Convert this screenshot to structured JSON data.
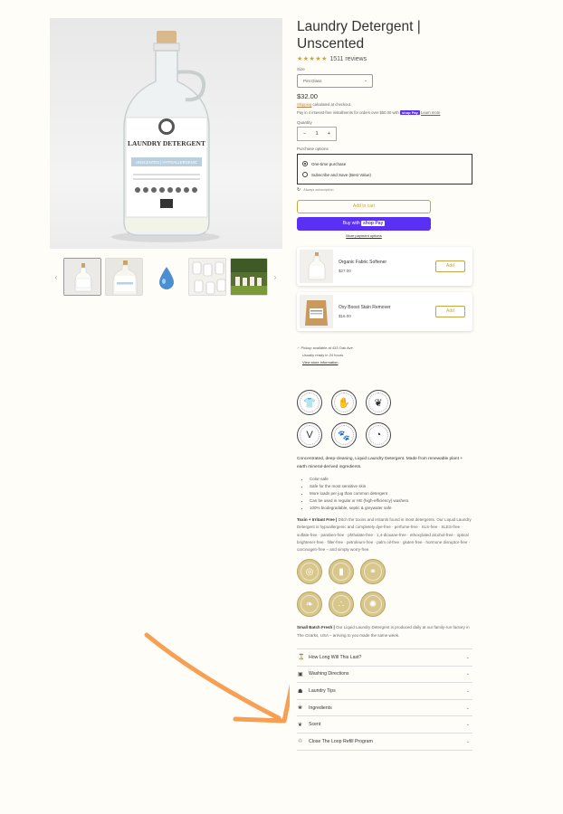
{
  "product": {
    "title": "Laundry Detergent | Unscented",
    "stars": "★★★★★",
    "review_count": "1511 reviews",
    "size_label": "Size",
    "size_value": "Pint Glass",
    "price": "$32.00",
    "shipping_link": "Shipping",
    "shipping_text": " calculated at checkout.",
    "installments_text": "Pay in 4 interest-free installments for orders over $50.00 with ",
    "shop_pay": "shop Pay",
    "learn_more": "Learn more",
    "quantity_label": "Quantity",
    "quantity_value": "1",
    "minus": "−",
    "plus": "+",
    "purchase_label": "Purchase options",
    "option_one_time": "One-time purchase",
    "option_subscribe": "Subscribe and Save (Best Value)",
    "policy_text": "Always subscription",
    "add_to_cart": "Add to cart",
    "buy_with": "Buy with ",
    "buy_shop": "shop Pay",
    "more_payment": "More payment options"
  },
  "gallery": {
    "label_brand": "LAUNDRY DETERGENT",
    "label_sub": "UNSCENTED | HYPOALLERGENIC",
    "prev_arrow": "‹",
    "next_arrow": "›"
  },
  "recommendations": [
    {
      "name": "Organic Fabric Softener",
      "price": "$27.00",
      "button": "Add"
    },
    {
      "name": "Oxy Boost Stain Remover",
      "price": "$16.00",
      "button": "Add"
    }
  ],
  "pickup": {
    "check": "✓",
    "line1": "Pickup available at 433 Oak Ave",
    "line2": "Usually ready in 24 hours",
    "link": "View store information"
  },
  "description": {
    "intro": "Concentrated, deep-cleaning, Liquid Laundry Detergent. Made from renewable plant + earth mineral-derived ingredients.",
    "bullets": [
      "Color-safe",
      "Safe for the most sensitive skin",
      "More loads per jug than common detergent",
      "Can be used in regular or HE (high-efficiency) washers.",
      "100% biodegradable, septic & greywater safe"
    ],
    "toxins_heading": "Toxin + Irritant Free |",
    "toxins_body": " Ditch the toxins and irritants found in most detergents. Our Liquid Laundry Detergent is hypoallergenic and completely dye-free · perfume-free · SLS-free · SLES-free · sulfate-free · paraben-free · phthalate-free · 1,4-dioxane-free · ethoxylated alcohol-free · optical brightener-free · filler-free · petroleum-free · palm oil-free · gluten-free · hormone disruptor-free · carcinogen-free – and simply worry-free.",
    "batch_heading": "Small Batch Fresh |",
    "batch_body": " Our Liquid Laundry Detergent is produced daily at our family-run factory in The Ozarks, USA – arriving to you made the same week."
  },
  "badges": [
    {
      "icon": "tshirt-icon",
      "glyph": "👕"
    },
    {
      "icon": "hands-icon",
      "glyph": "✋"
    },
    {
      "icon": "leaf-icon",
      "glyph": "❦"
    },
    {
      "icon": "vegan-icon",
      "glyph": "V"
    },
    {
      "icon": "paw-icon",
      "glyph": "🐾"
    },
    {
      "icon": "recycle-icon",
      "glyph": "◔"
    }
  ],
  "gold_badges": [
    {
      "icon": "no-residue-icon",
      "glyph": "◎"
    },
    {
      "icon": "bottle-icon",
      "glyph": "▮"
    },
    {
      "icon": "bone-icon",
      "glyph": "⚭"
    },
    {
      "icon": "wheat-icon",
      "glyph": "❧"
    },
    {
      "icon": "drops-icon",
      "glyph": "∴"
    },
    {
      "icon": "atom-icon",
      "glyph": "✺"
    }
  ],
  "accordion": [
    {
      "label": "How Long Will This Last?",
      "icon": "hourglass-icon",
      "glyph": "⌛"
    },
    {
      "label": "Washing Directions",
      "icon": "washer-icon",
      "glyph": "▣"
    },
    {
      "label": "Laundry Tips",
      "icon": "shirt-icon",
      "glyph": "☗"
    },
    {
      "label": "Ingredients",
      "icon": "ingredients-icon",
      "glyph": "❀"
    },
    {
      "label": "Scent",
      "icon": "leaf-icon",
      "glyph": "❦"
    },
    {
      "label": "Close The Loop Refill Program",
      "icon": "recycle-icon",
      "glyph": "♲"
    }
  ],
  "colors": {
    "accent_gold": "#c9a442",
    "shop_pay_purple": "#5a31f4",
    "annotation_arrow": "#f7a054"
  }
}
